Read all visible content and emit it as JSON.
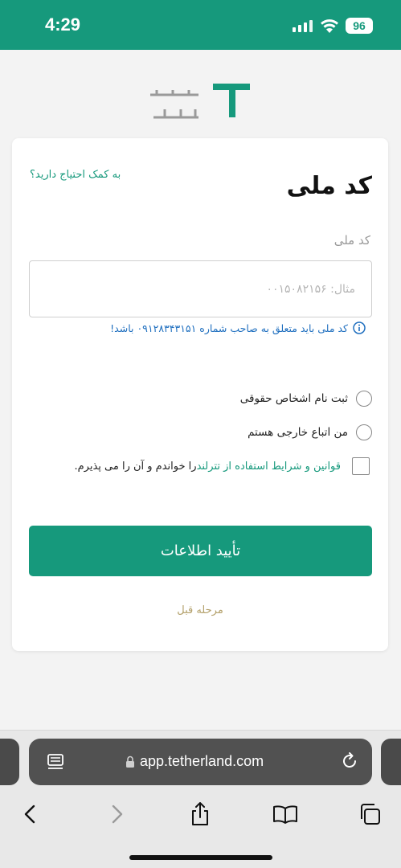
{
  "status_bar": {
    "time": "4:29",
    "battery": "96"
  },
  "form": {
    "help_link": "به کمک احتیاج دارید؟",
    "title": "کد ملی",
    "field_label": "کد ملی",
    "input_placeholder": "مثال: ۰۰۱۵۰۸۲۱۵۶",
    "input_value": "",
    "hint": "کد ملی باید متعلق به صاحب شماره ۰۹۱۲۸۳۴۳۱۵۱ باشد!",
    "options": [
      {
        "label": "ثبت نام اشخاص حقوقی",
        "checked": false
      },
      {
        "label": "من اتباع خارجی هستم",
        "checked": false
      }
    ],
    "terms_link": "قوانین و شرایط استفاده از تترلند",
    "terms_suffix": "را خواندم و آن را می پذیرم.",
    "terms_checked": false,
    "submit_label": "تأیید اطلاعات",
    "back_label": "مرحله قبل"
  },
  "browser": {
    "url": "app.tetherland.com"
  },
  "colors": {
    "brand": "#16997c",
    "link_blue": "#1f6fbf",
    "back_gold": "#b3a06a"
  },
  "icons": [
    "signal-icon",
    "wifi-icon",
    "battery-icon",
    "tetherland-logo",
    "info-icon",
    "reader-icon",
    "lock-icon",
    "reload-icon",
    "back-icon",
    "forward-icon",
    "share-icon",
    "bookmarks-icon",
    "tabs-icon"
  ]
}
